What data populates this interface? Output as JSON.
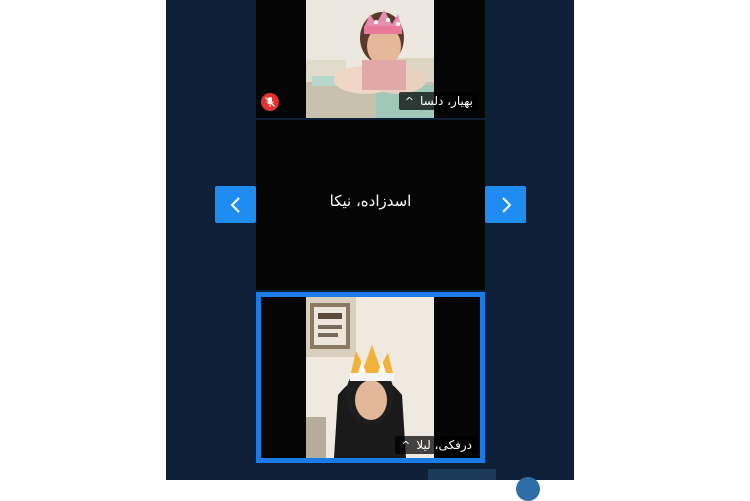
{
  "participants": [
    {
      "name": "بهیار، دلسا",
      "caret": "^",
      "muted": true,
      "mic_icon": "mic-off-icon"
    },
    {
      "name": "اسدزاده، نیکا",
      "video": false
    },
    {
      "name": "درفکی، لیلا",
      "caret": "^",
      "active_speaker": true
    }
  ],
  "navigation": {
    "prev_icon": "chevron-left-icon",
    "next_icon": "chevron-right-icon"
  },
  "colors": {
    "app_background": "#0d2038",
    "tile_background": "#050505",
    "active_border": "#1a7be6",
    "nav_button": "#1e8cf0",
    "mute_badge": "#e0322e"
  }
}
